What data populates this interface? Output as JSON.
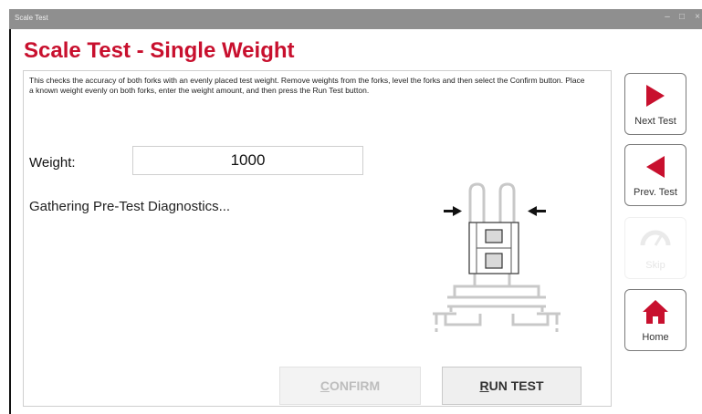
{
  "window": {
    "title": "Scale Test",
    "minimize_glyph": "–",
    "maximize_glyph": "□",
    "close_glyph": "×"
  },
  "page": {
    "title": "Scale Test - Single Weight",
    "description": "This checks the accuracy of both forks with an evenly placed test weight. Remove weights from the forks, level the forks and then select the Confirm button. Place a known weight evenly on both forks, enter the weight amount, and then press the Run Test button."
  },
  "weight": {
    "label": "Weight:",
    "value": "1000"
  },
  "status_text": "Gathering Pre-Test Diagnostics...",
  "buttons": {
    "confirm": {
      "prefix": "",
      "accel": "C",
      "rest": "ONFIRM",
      "enabled": false
    },
    "run_test": {
      "prefix": "",
      "accel": "R",
      "rest": "UN TEST",
      "enabled": true
    }
  },
  "sidebar": {
    "next_test": {
      "label": "Next Test",
      "icon": "arrow-right-icon",
      "enabled": true
    },
    "prev_test": {
      "label": "Prev. Test",
      "icon": "arrow-left-icon",
      "enabled": true
    },
    "skip": {
      "label": "Skip",
      "icon": "gauge-icon",
      "enabled": false
    },
    "home": {
      "label": "Home",
      "icon": "home-icon",
      "enabled": true
    }
  },
  "colors": {
    "brand_red": "#c8102e",
    "disabled_text": "#bdbdbd"
  }
}
